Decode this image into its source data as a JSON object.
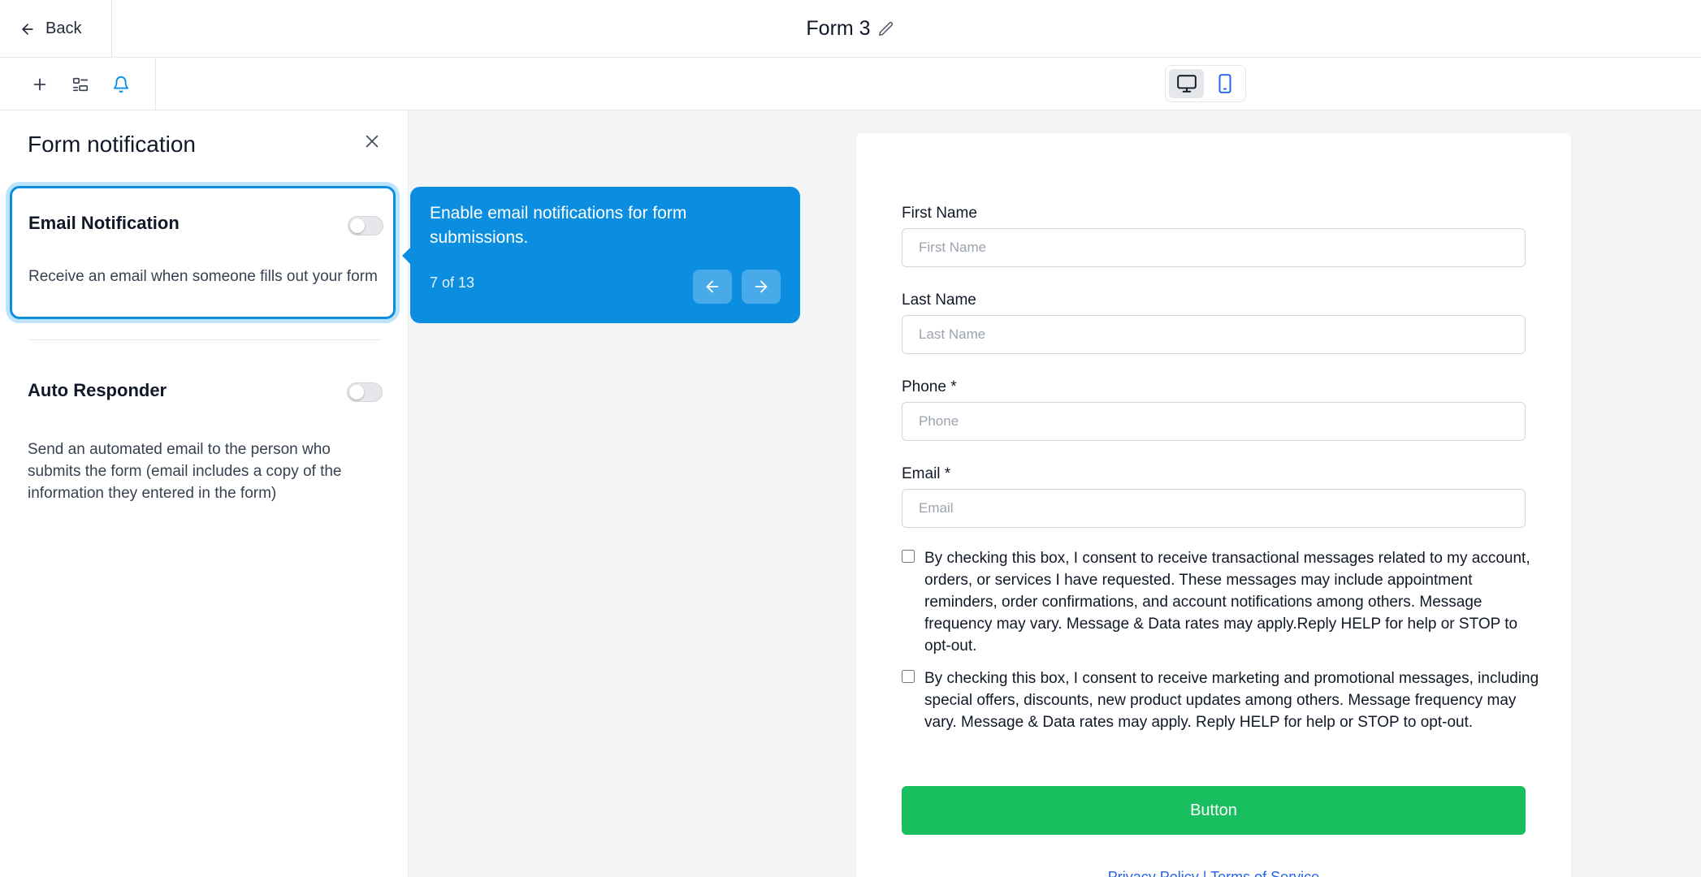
{
  "header": {
    "back_label": "Back",
    "form_title": "Form 3"
  },
  "toolbar": {
    "tools": [
      "plus-icon",
      "layout-icon",
      "bell-icon"
    ]
  },
  "panel": {
    "title": "Form notification",
    "email": {
      "title": "Email Notification",
      "description": "Receive an email when someone fills out your form",
      "enabled": false
    },
    "auto_responder": {
      "title": "Auto Responder",
      "description": "Send an automated email to the person who submits the form (email includes a copy of the information they entered in the form)",
      "enabled": false
    }
  },
  "tooltip": {
    "text": "Enable email notifications for form submissions.",
    "step": "7 of 13"
  },
  "form": {
    "fields": [
      {
        "label": "First Name",
        "placeholder": "First Name"
      },
      {
        "label": "Last Name",
        "placeholder": "Last Name"
      },
      {
        "label": "Phone *",
        "placeholder": "Phone"
      },
      {
        "label": "Email *",
        "placeholder": "Email"
      }
    ],
    "consent_transactional": "By checking this box, I consent to receive transactional messages related to my account, orders, or services I have requested. These messages may include appointment reminders, order confirmations, and account notifications among others. Message frequency may vary. Message & Data rates may apply.Reply HELP for help or STOP to opt-out.",
    "consent_marketing": "By checking this box, I consent to receive marketing and promotional messages, including special offers, discounts, new product updates among others. Message frequency may vary. Message & Data rates may apply. Reply HELP for help or STOP to opt-out.",
    "button_label": "Button",
    "footer_links": "Privacy Policy | Terms of Service"
  },
  "colors": {
    "accent": "#0b8ee0",
    "button": "#19be5f"
  }
}
